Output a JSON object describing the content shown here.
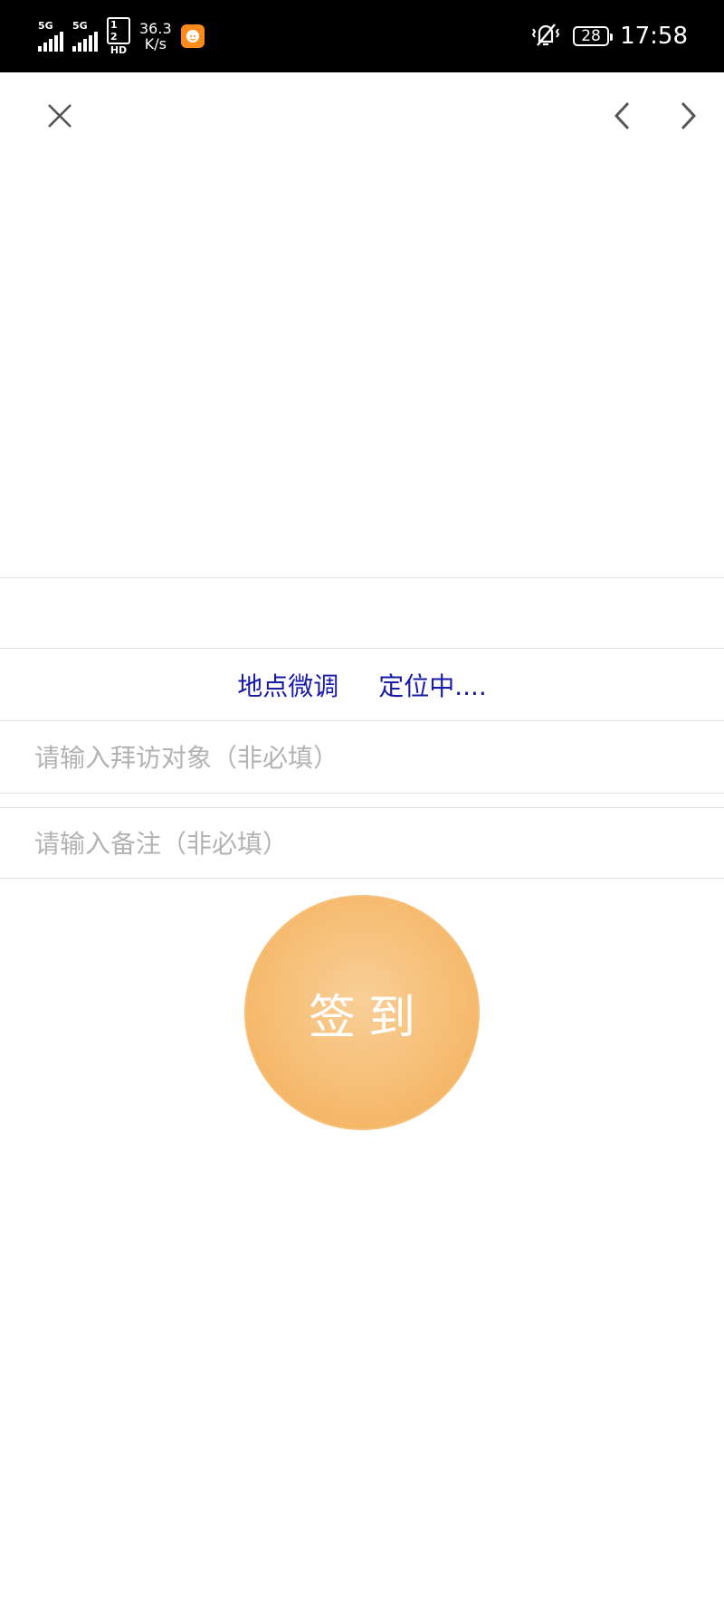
{
  "status_bar": {
    "signal_1_tag": "5G",
    "signal_2_tag": "5G",
    "hd_top": "1 2",
    "hd_bottom": "HD",
    "speed_value": "36.3",
    "speed_unit": "K/s",
    "app_icon": "orange-app-icon",
    "mute_icon": "vibrate-off-icon",
    "battery_level": "28",
    "time": "17:58"
  },
  "nav": {
    "close_icon": "close-icon",
    "back_icon": "chevron-left-icon",
    "forward_icon": "chevron-right-icon"
  },
  "location": {
    "address_text": "",
    "adjust_link": "地点微调",
    "status_text": "定位中...."
  },
  "form": {
    "visitor_placeholder": "请输入拜访对象（非必填）",
    "visitor_value": "",
    "remark_placeholder": "请输入备注（非必填）",
    "remark_value": ""
  },
  "checkin": {
    "label": "签到",
    "color": "#f6bd73"
  },
  "colors": {
    "link": "#1a1aa8",
    "placeholder": "#b3b3b3",
    "divider": "#e3e3e3"
  }
}
